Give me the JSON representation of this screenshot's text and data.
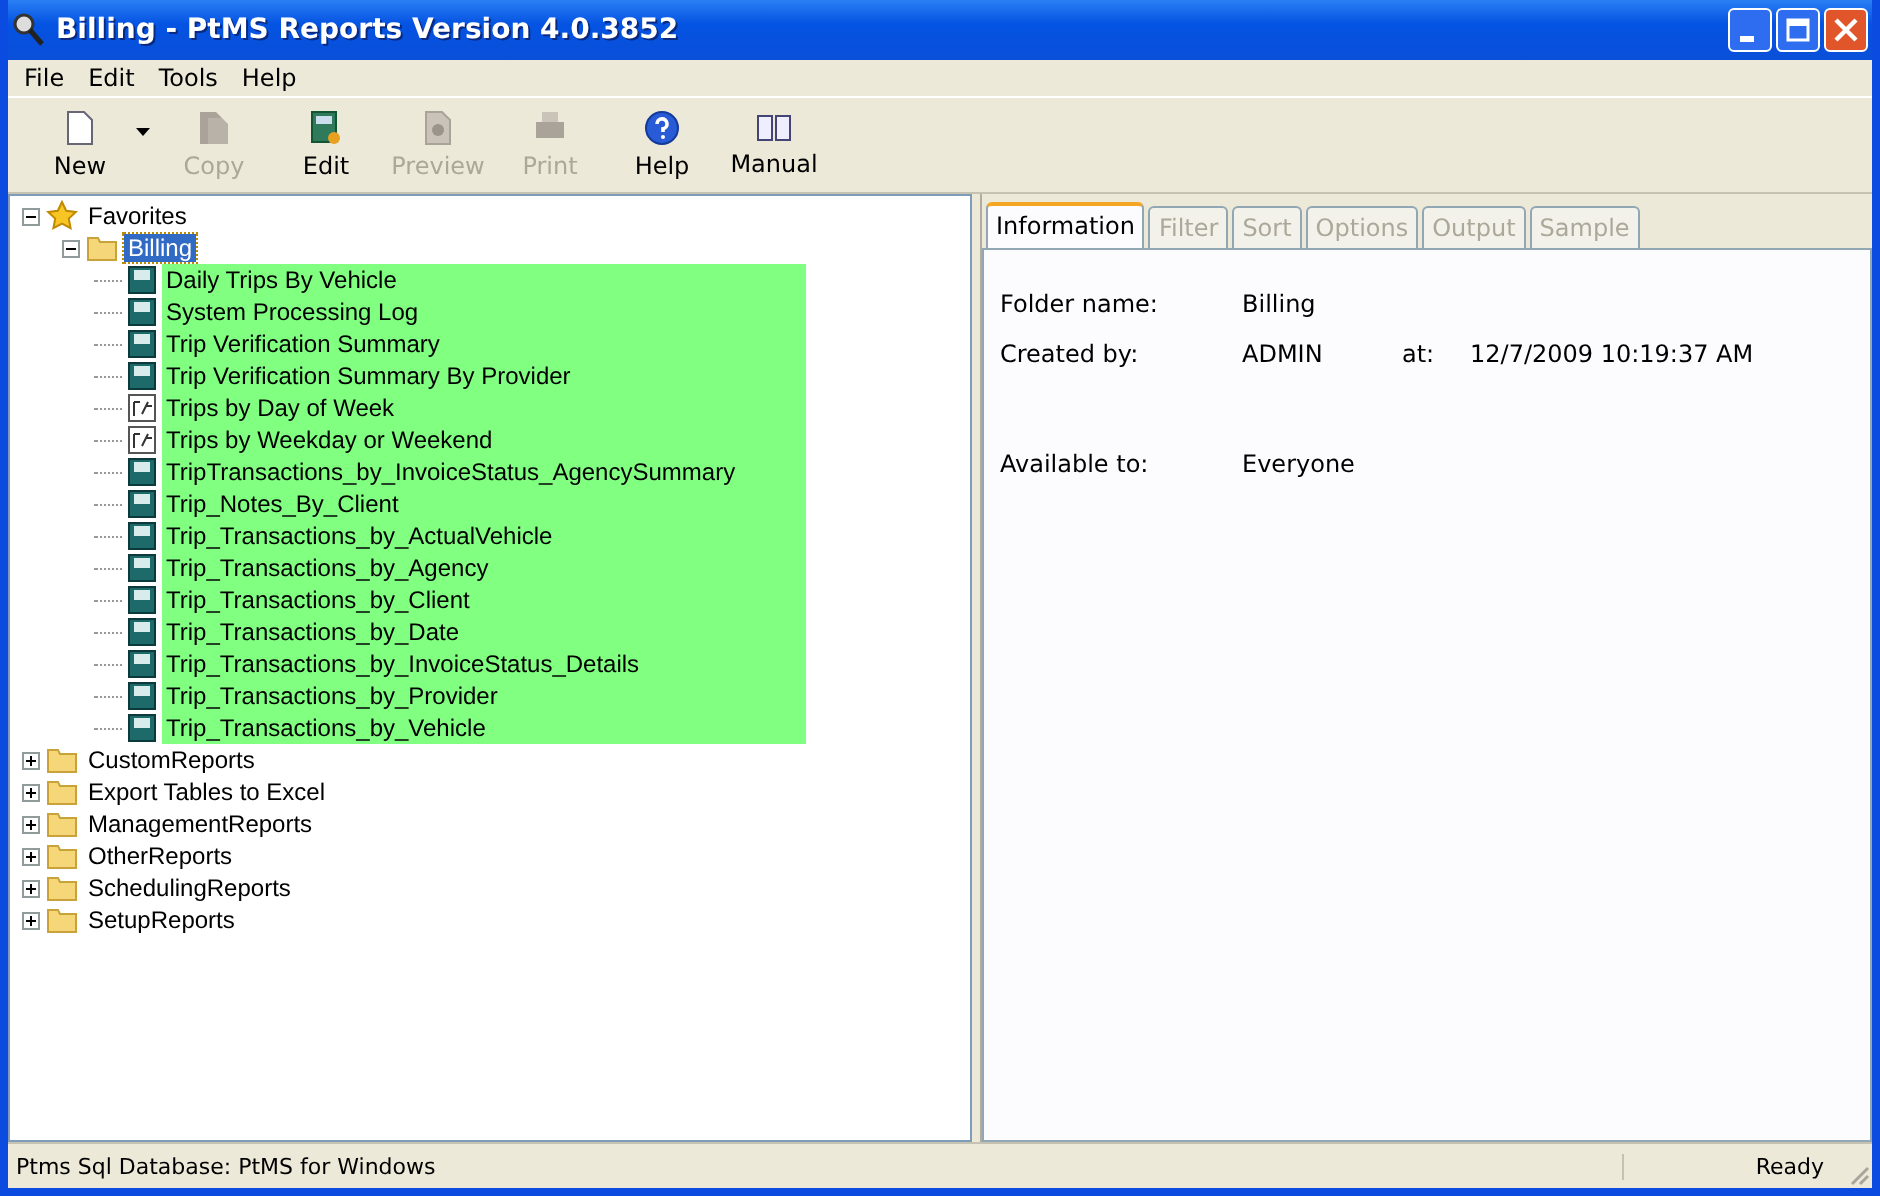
{
  "window": {
    "title": "Billing - PtMS Reports Version 4.0.3852"
  },
  "menu": [
    "File",
    "Edit",
    "Tools",
    "Help"
  ],
  "toolbar": [
    {
      "label": "New",
      "disabled": false,
      "dropdown": true
    },
    {
      "label": "Copy",
      "disabled": true,
      "dropdown": false
    },
    {
      "label": "Edit",
      "disabled": false,
      "dropdown": false
    },
    {
      "label": "Preview",
      "disabled": true,
      "dropdown": false
    },
    {
      "label": "Print",
      "disabled": true,
      "dropdown": false
    },
    {
      "label": "Help",
      "disabled": false,
      "dropdown": false
    },
    {
      "label": "Manual",
      "disabled": false,
      "dropdown": false
    }
  ],
  "tree": [
    {
      "label": "Favorites",
      "kind": "favorites",
      "expanded": true,
      "selected": false,
      "children": [
        {
          "label": "Billing",
          "kind": "folder",
          "expanded": true,
          "selected": true,
          "highlighted": true,
          "children": [
            {
              "label": "Daily Trips By Vehicle",
              "kind": "report"
            },
            {
              "label": "System Processing Log",
              "kind": "report"
            },
            {
              "label": "Trip Verification Summary",
              "kind": "report"
            },
            {
              "label": "Trip Verification Summary By Provider",
              "kind": "report"
            },
            {
              "label": "Trips by Day of Week",
              "kind": "query"
            },
            {
              "label": "Trips by Weekday or Weekend",
              "kind": "query"
            },
            {
              "label": "TripTransactions_by_InvoiceStatus_AgencySummary",
              "kind": "report"
            },
            {
              "label": "Trip_Notes_By_Client",
              "kind": "report"
            },
            {
              "label": "Trip_Transactions_by_ActualVehicle",
              "kind": "report"
            },
            {
              "label": "Trip_Transactions_by_Agency",
              "kind": "report"
            },
            {
              "label": "Trip_Transactions_by_Client",
              "kind": "report"
            },
            {
              "label": "Trip_Transactions_by_Date",
              "kind": "report"
            },
            {
              "label": "Trip_Transactions_by_InvoiceStatus_Details",
              "kind": "report"
            },
            {
              "label": "Trip_Transactions_by_Provider",
              "kind": "report"
            },
            {
              "label": "Trip_Transactions_by_Vehicle",
              "kind": "report"
            }
          ]
        }
      ]
    },
    {
      "label": "CustomReports",
      "kind": "folder",
      "expanded": false,
      "selected": false
    },
    {
      "label": "Export Tables to Excel",
      "kind": "folder",
      "expanded": false,
      "selected": false
    },
    {
      "label": "ManagementReports",
      "kind": "folder",
      "expanded": false,
      "selected": false
    },
    {
      "label": "OtherReports",
      "kind": "folder",
      "expanded": false,
      "selected": false
    },
    {
      "label": "SchedulingReports",
      "kind": "folder",
      "expanded": false,
      "selected": false
    },
    {
      "label": "SetupReports",
      "kind": "folder",
      "expanded": false,
      "selected": false
    }
  ],
  "tabs": [
    {
      "label": "Information",
      "selected": true,
      "disabled": false
    },
    {
      "label": "Filter",
      "selected": false,
      "disabled": true
    },
    {
      "label": "Sort",
      "selected": false,
      "disabled": true
    },
    {
      "label": "Options",
      "selected": false,
      "disabled": true
    },
    {
      "label": "Output",
      "selected": false,
      "disabled": true
    },
    {
      "label": "Sample",
      "selected": false,
      "disabled": true
    }
  ],
  "info": {
    "folder_label": "Folder name:",
    "folder_value": "Billing",
    "created_label": "Created by:",
    "created_value": "ADMIN",
    "at_label": "at:",
    "at_value": "12/7/2009 10:19:37 AM",
    "available_label": "Available to:",
    "available_value": "Everyone"
  },
  "status_bar": {
    "left": "Ptms Sql Database: PtMS for Windows",
    "right": "Ready"
  }
}
